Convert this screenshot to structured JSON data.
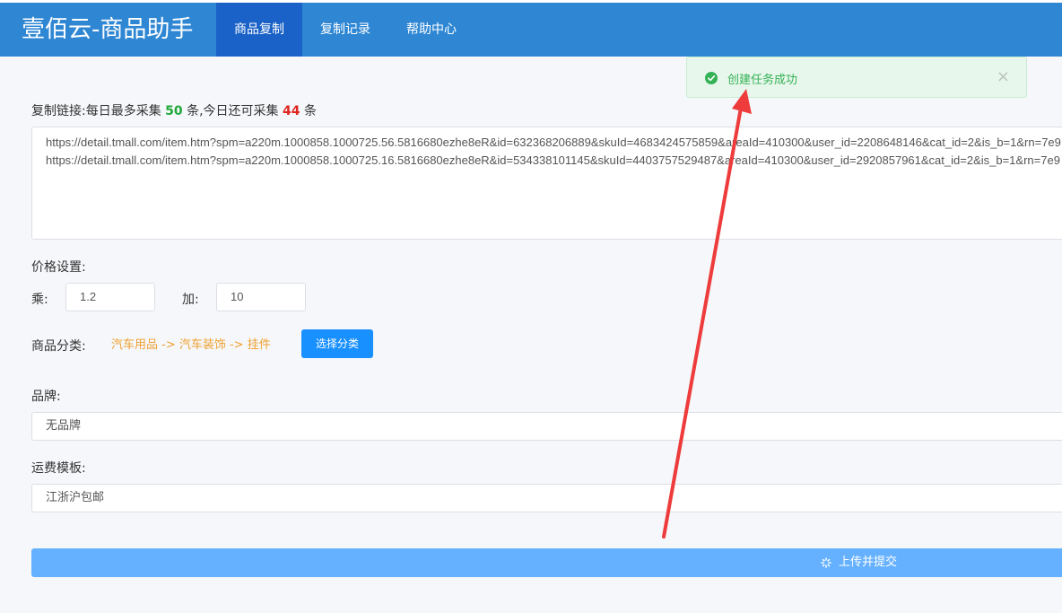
{
  "app": {
    "title": "壹佰云-商品助手"
  },
  "nav": {
    "items": [
      {
        "label": "商品复制"
      },
      {
        "label": "复制记录"
      },
      {
        "label": "帮助中心"
      }
    ],
    "active_index": 0
  },
  "copy_link": {
    "label_prefix": "复制链接:每日最多采集",
    "max_count": "50",
    "label_middle": "条,今日还可采集",
    "remaining_count": "44",
    "label_suffix": "条",
    "value": "https://detail.tmall.com/item.htm?spm=a220m.1000858.1000725.56.5816680ezhe8eR&id=632368206889&skuId=4683424575859&areaId=410300&user_id=2208648146&cat_id=2&is_b=1&rn=7e9\nhttps://detail.tmall.com/item.htm?spm=a220m.1000858.1000725.16.5816680ezhe8eR&id=534338101145&skuId=4403757529487&areaId=410300&user_id=2920857961&cat_id=2&is_b=1&rn=7e9"
  },
  "price": {
    "label": "价格设置:",
    "multiply_label": "乘:",
    "multiply_value": "1.2",
    "add_label": "加:",
    "add_value": "10"
  },
  "category": {
    "label": "商品分类:",
    "path": "汽车用品 -> 汽车装饰 -> 挂件",
    "select_button": "选择分类"
  },
  "brand": {
    "label": "品牌:",
    "value": "无品牌"
  },
  "shipping": {
    "label": "运费模板:",
    "value": "江浙沪包邮"
  },
  "submit": {
    "label": "上传并提交"
  },
  "toast": {
    "message": "创建任务成功",
    "close_glyph": "×"
  },
  "colors": {
    "header": "#2f87d4",
    "nav_active": "#1a62c7",
    "primary": "#1890ff",
    "submit_loading": "#66b1ff",
    "success": "#34b255",
    "category_path": "#f0a030",
    "arrow": "#ee3b3b"
  },
  "icons": {
    "toast": "check-circle-icon",
    "submit": "loading-spinner-icon",
    "close": "close-icon"
  }
}
